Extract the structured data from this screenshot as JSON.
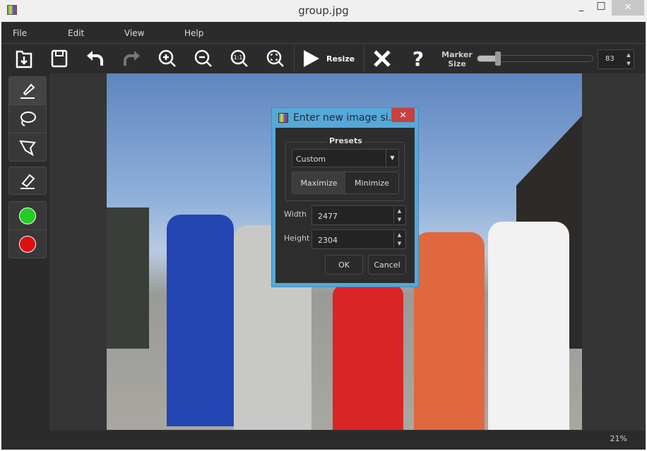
{
  "window": {
    "title": "group.jpg",
    "minimize": "_",
    "maximize": "□",
    "close": "✕"
  },
  "menu": [
    "File",
    "Edit",
    "View",
    "Help"
  ],
  "toolbar": {
    "resize_label": "Resize",
    "marker_size_label_1": "Marker",
    "marker_size_label_2": "Size",
    "marker_size_value": "83",
    "marker_size_slider_fraction": 0.18
  },
  "colors": {
    "green": "#22cc22",
    "red": "#dd1111",
    "dialog_border": "#57a8d8",
    "dialog_close": "#c9413f",
    "mask": "#d92525"
  },
  "status": {
    "zoom": "21%"
  },
  "dialog": {
    "title": "Enter new image si...",
    "close": "✕",
    "presets_label": "Presets",
    "preset_value": "Custom",
    "maximize": "Maximize",
    "minimize": "Minimize",
    "width_label": "Width",
    "width_value": "2477",
    "height_label": "Height",
    "height_value": "2304",
    "ok": "OK",
    "cancel": "Cancel"
  }
}
